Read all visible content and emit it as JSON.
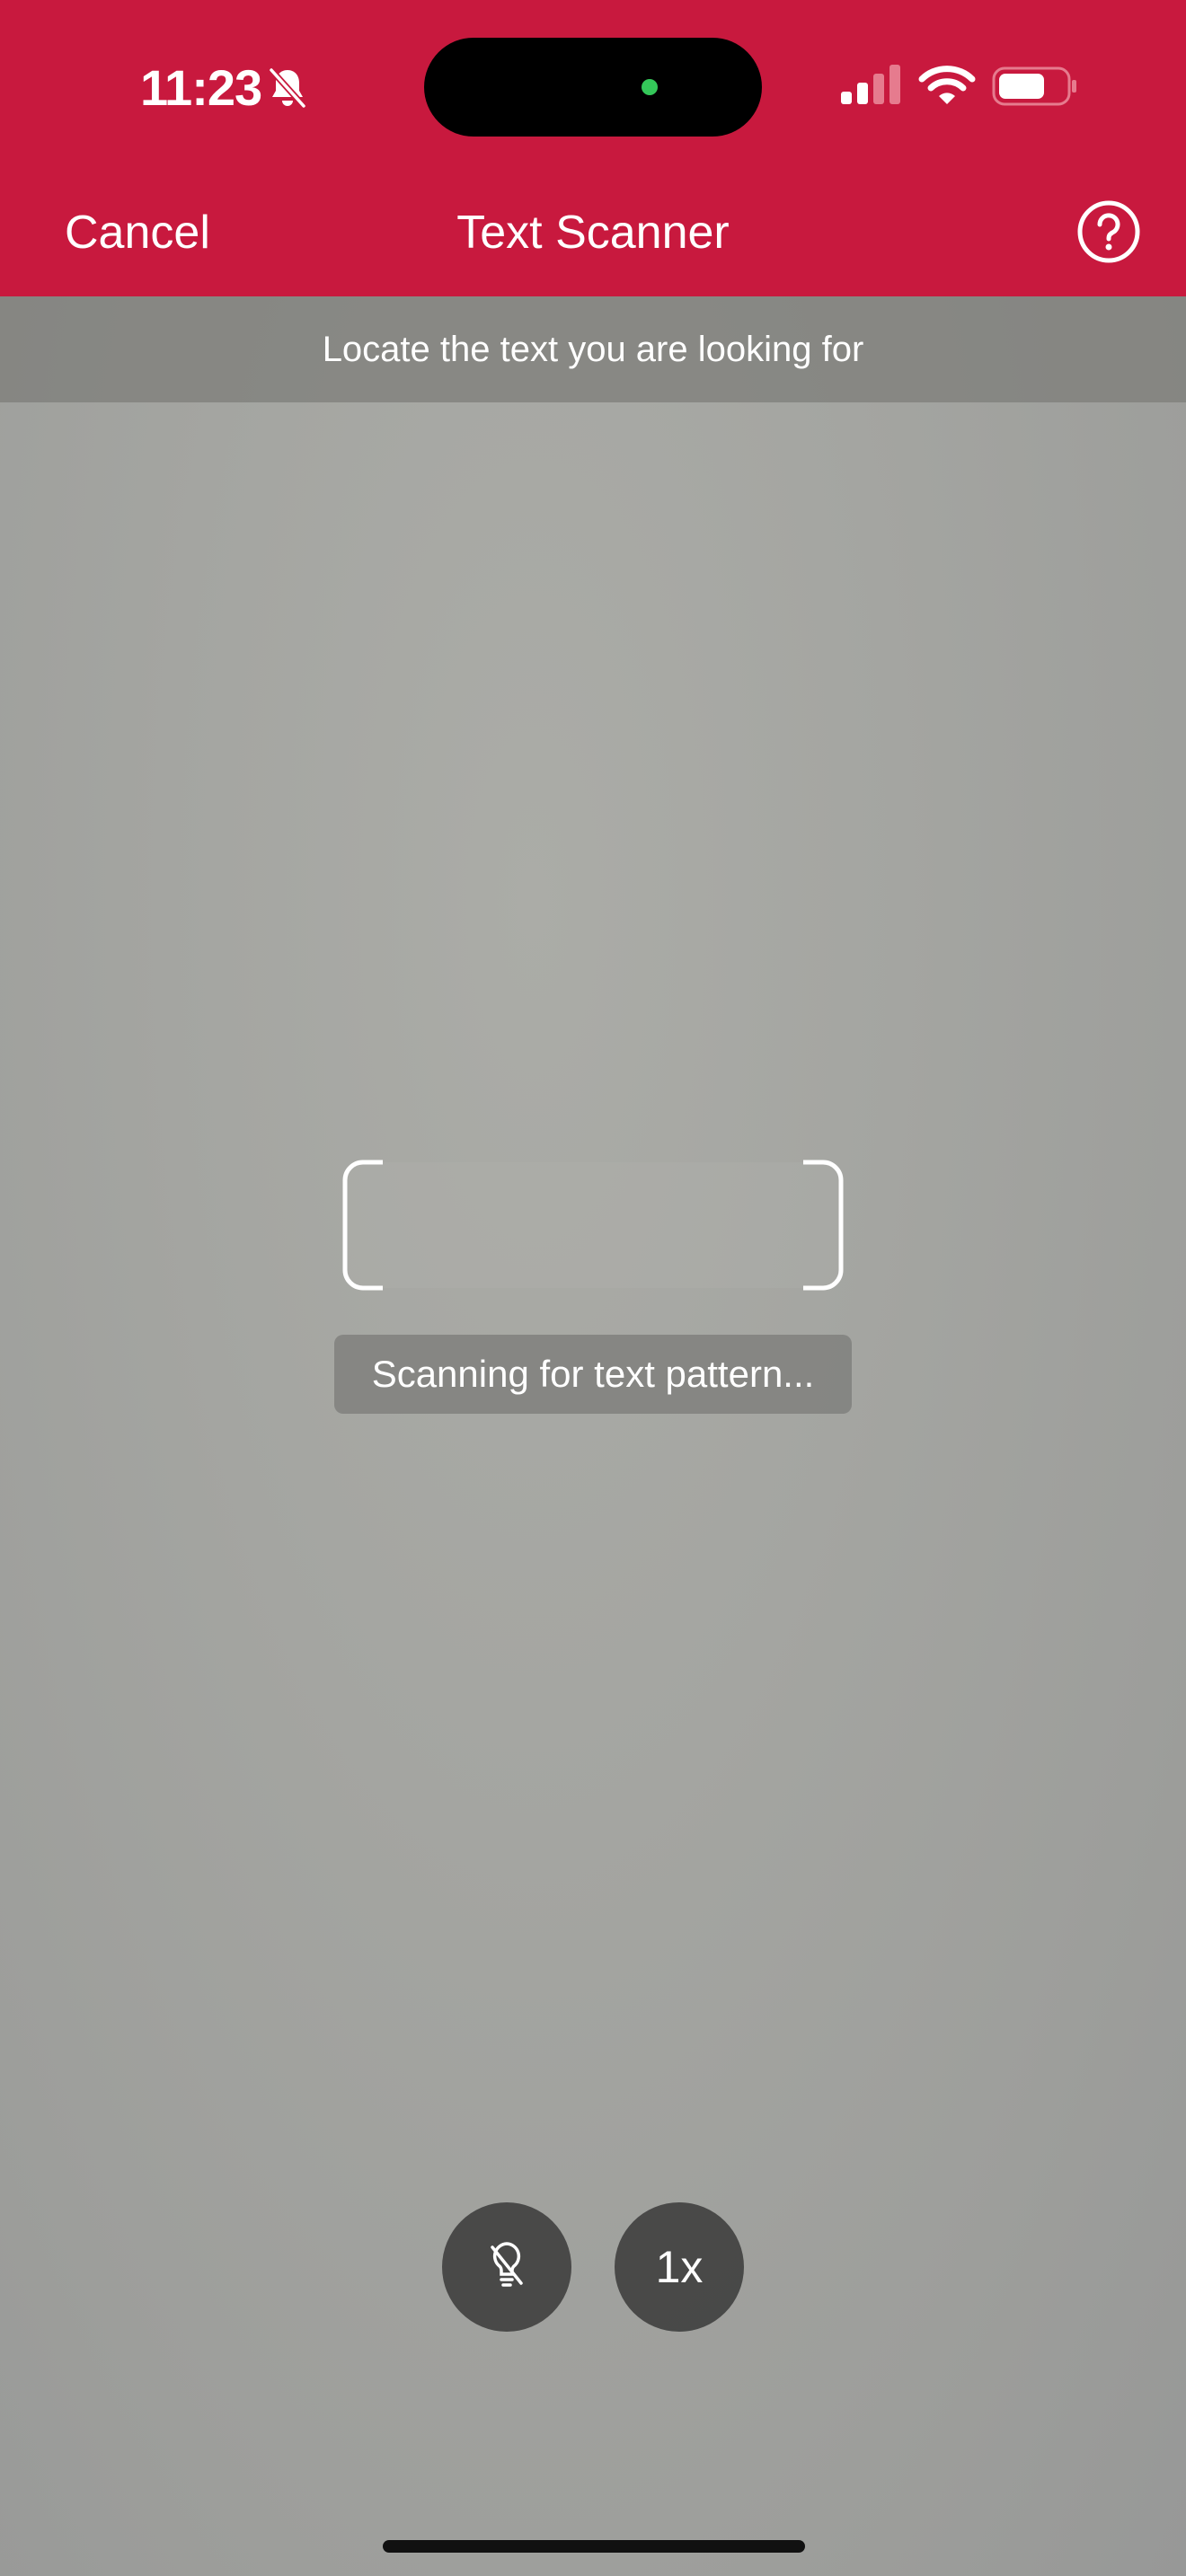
{
  "status_bar": {
    "time": "11:23",
    "icons": [
      "bell-slash-icon",
      "signal-icon",
      "wifi-icon",
      "battery-icon"
    ],
    "camera_indicator_color": "#34c759"
  },
  "nav": {
    "cancel_label": "Cancel",
    "title": "Text Scanner",
    "help_icon": "question-circle-icon",
    "background_color": "#c8193e"
  },
  "banner": {
    "instruction": "Locate the text you are looking for"
  },
  "scanner": {
    "status": "Scanning for text pattern..."
  },
  "controls": {
    "torch_icon": "flashlight-off-icon",
    "zoom_label": "1x"
  }
}
